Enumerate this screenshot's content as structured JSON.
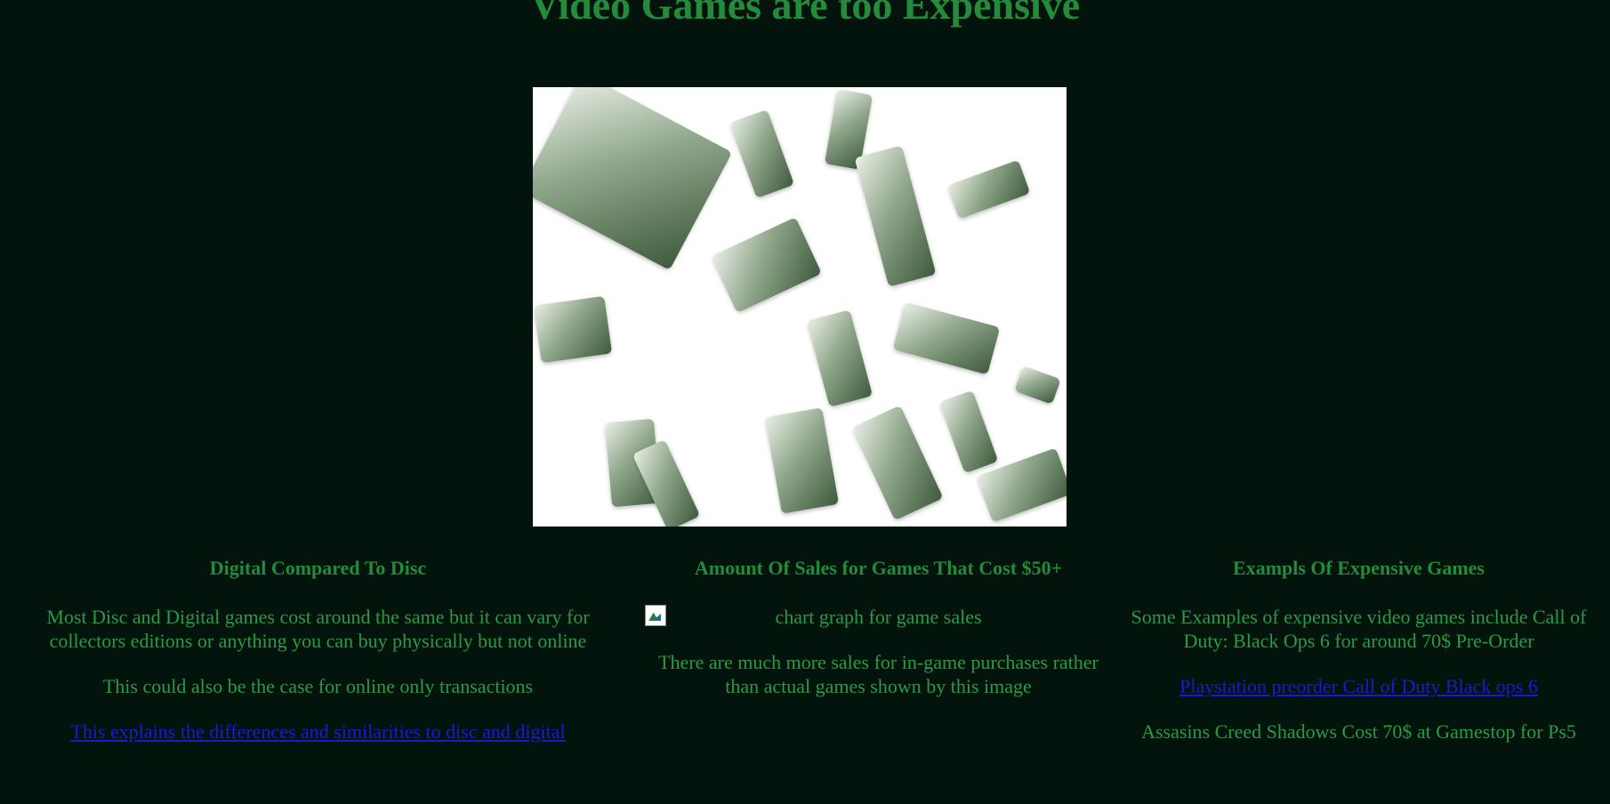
{
  "page": {
    "title": "Video Games are too Expensive"
  },
  "hero_image": {
    "subject": "falling hundred dollar bills"
  },
  "columns": {
    "left": {
      "heading": "Digital Compared To Disc",
      "paragraph1": "Most Disc and Digital games cost around the same but it can vary for collectors editions or anything you can buy physically but not online",
      "paragraph2": "This could also be the case for online only transactions",
      "link": "This explains the differences and similarities to disc and digital"
    },
    "middle": {
      "heading": "Amount Of Sales for Games That Cost $50+",
      "image_alt": "chart graph for game sales",
      "paragraph": "There are much more sales for in-game purchases rather than actual games shown by this image"
    },
    "right": {
      "heading": "Exampls Of Expensive Games",
      "paragraph1": "Some Examples of expensive video games include Call of Duty: Black Ops 6 for around 70$ Pre-Order",
      "link1": "Playstation preorder Call of Duty Black ops 6",
      "paragraph2": "Assasins Creed Shadows Cost 70$ at Gamestop for Ps5"
    }
  },
  "colors": {
    "background": "#03140c",
    "text_green": "#238b3b",
    "link_blue": "#1a1ad6"
  }
}
